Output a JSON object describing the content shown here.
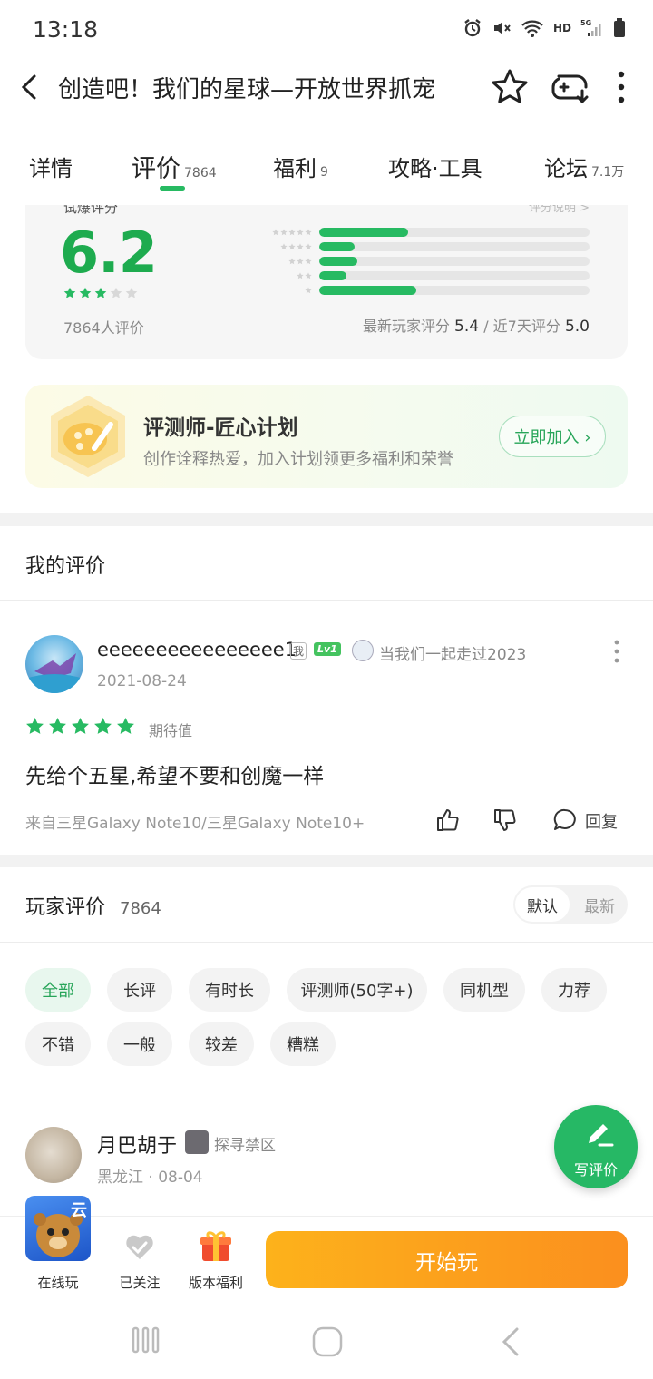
{
  "status_bar": {
    "time": "13:18",
    "network": "HD",
    "signal": "5G"
  },
  "header": {
    "title": "创造吧！我们的星球—开放世界抓宠"
  },
  "tabs": [
    {
      "label": "详情",
      "count": ""
    },
    {
      "label": "评价",
      "count": "7864"
    },
    {
      "label": "福利",
      "count": "9"
    },
    {
      "label": "攻略·工具",
      "count": ""
    },
    {
      "label": "论坛",
      "count": "7.1万"
    }
  ],
  "rating": {
    "label": "试爆评分",
    "note": "评分说明 >",
    "score": "6.2",
    "star_level": 3,
    "count_text": "7864人评价",
    "distribution": [
      {
        "stars": 5,
        "fraction": 0.33
      },
      {
        "stars": 4,
        "fraction": 0.13
      },
      {
        "stars": 3,
        "fraction": 0.14
      },
      {
        "stars": 2,
        "fraction": 0.1
      },
      {
        "stars": 1,
        "fraction": 0.36
      }
    ],
    "latest_label": "最新玩家评分",
    "latest_value": "5.4",
    "separator": "/",
    "week_label": "近7天评分",
    "week_value": "5.0"
  },
  "banner": {
    "title": "评测师-匠心计划",
    "subtitle": "创作诠释热爱，加入计划领更多福利和荣誉",
    "button": "立即加入 ›"
  },
  "my_review": {
    "section_title": "我的评价",
    "username": "eeeeeeeeeeeeeeee1",
    "me_badge": "我",
    "level": "Lv1",
    "tag": "当我们一起走过2023",
    "date": "2021-08-24",
    "stars": 5,
    "rating_label": "期待值",
    "content": "先给个五星,希望不要和创魔一样",
    "device": "来自三星Galaxy Note10/三星Galaxy Note10+",
    "reply_label": "回复"
  },
  "player_reviews": {
    "title": "玩家评价",
    "count": "7864",
    "sort_default": "默认",
    "sort_newest": "最新",
    "filters": [
      "全部",
      "长评",
      "有时长",
      "评测师(50字+)",
      "同机型",
      "力荐",
      "不错",
      "一般",
      "较差",
      "糟糕"
    ],
    "first": {
      "username": "月巴胡于",
      "tag": "探寻禁区",
      "location": "黑龙江 · 08-04"
    }
  },
  "fab": {
    "label": "写评价"
  },
  "bottom_bar": {
    "cloud_badge": "云",
    "online_label": "在线玩",
    "follow_label": "已关注",
    "gift_label": "版本福利",
    "play_label": "开始玩"
  },
  "colors": {
    "accent": "#27ba62",
    "play_orange": "#fc9f1c",
    "bar_track": "#e6e6e6"
  }
}
